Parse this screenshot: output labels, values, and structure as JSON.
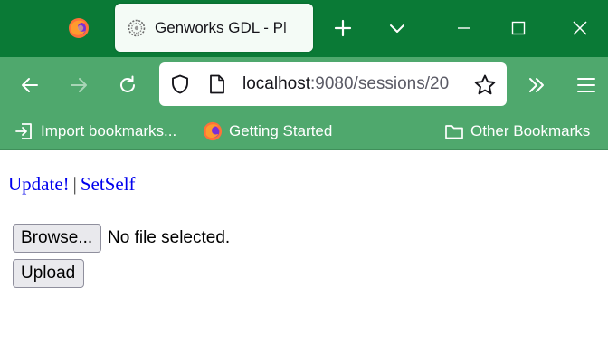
{
  "browser": {
    "tab": {
      "title": "Genworks GDL - Pl",
      "favicon": "genworks-logo-icon"
    },
    "toolbar": {
      "url_host": "localhost",
      "url_rest": ":9080/sessions/20"
    },
    "bookmarks": {
      "items": [
        {
          "label": "Import bookmarks...",
          "icon": "import-icon"
        },
        {
          "label": "Getting Started",
          "icon": "firefox-icon"
        }
      ],
      "other": {
        "label": "Other Bookmarks",
        "icon": "folder-icon"
      }
    },
    "colors": {
      "tabstrip": "#0a7a36",
      "toolbar": "#4fa86d",
      "link": "#0000ee"
    }
  },
  "page": {
    "links": {
      "update": "Update!",
      "separator": "|",
      "setself": "SetSelf"
    },
    "file_input": {
      "browse_label": "Browse...",
      "status": "No file selected."
    },
    "upload_label": "Upload"
  }
}
